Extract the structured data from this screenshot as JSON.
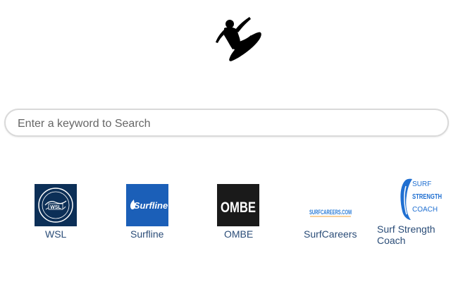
{
  "search": {
    "placeholder": "Enter a keyword to Search",
    "value": ""
  },
  "logo": {
    "icon": "surfer-silhouette-icon"
  },
  "shortcuts": [
    {
      "label": "WSL",
      "icon": "wsl-logo-icon",
      "icon_text": "WSL",
      "color": "#0c2f57"
    },
    {
      "label": "Surfline",
      "icon": "surfline-logo-icon",
      "icon_text": "Surfline",
      "color": "#1b5fb8"
    },
    {
      "label": "OMBE",
      "icon": "ombe-logo-icon",
      "icon_text": "OMBE",
      "color": "#1a1a1a"
    },
    {
      "label": "SurfCareers",
      "icon": "surfcareers-logo-icon",
      "icon_text": "SURFCAREERS.COM",
      "color": "#2a7bd6"
    },
    {
      "label": "Surf Strength Coach",
      "icon": "surf-strength-coach-logo-icon",
      "icon_text_lines": [
        "SURF",
        "STRENGTH",
        "COACH"
      ],
      "color": "#1f6fd1"
    }
  ]
}
